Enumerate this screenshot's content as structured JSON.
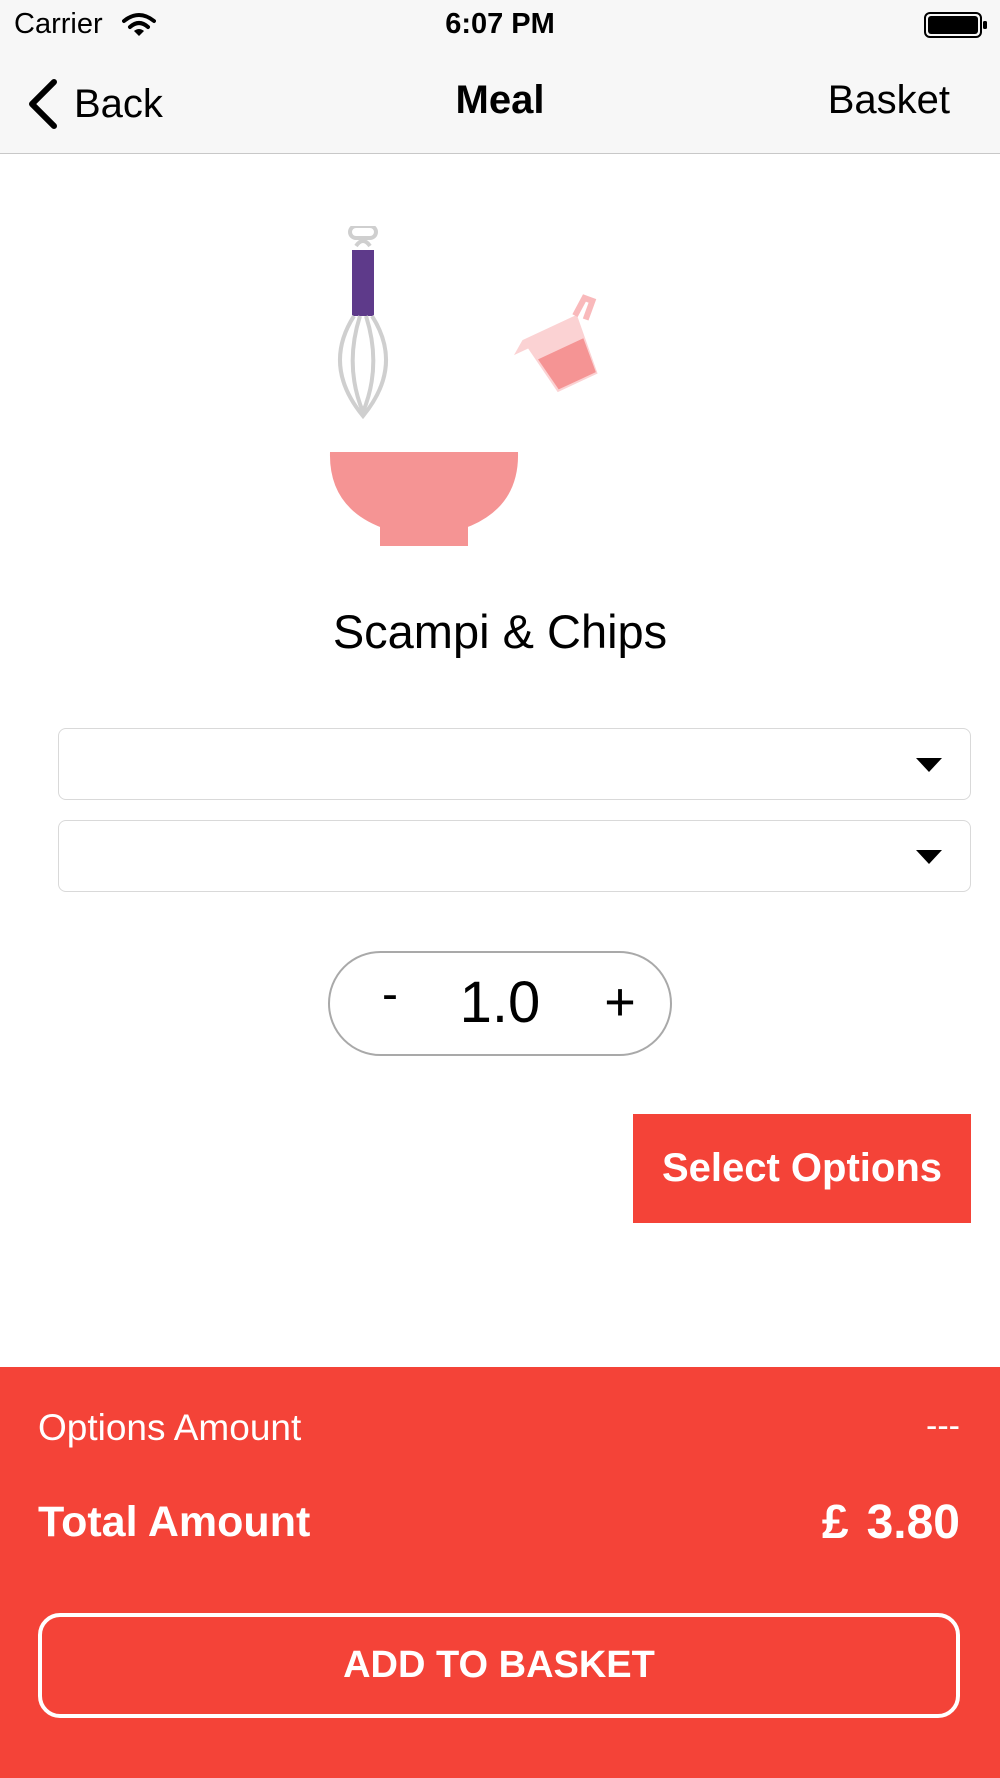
{
  "status_bar": {
    "carrier": "Carrier",
    "time": "6:07 PM",
    "wifi_icon": "wifi-icon",
    "battery_icon": "battery-icon"
  },
  "nav": {
    "back_label": "Back",
    "back_icon": "chevron-left-icon",
    "title": "Meal",
    "basket_label": "Basket"
  },
  "illustration_icon": "whisk-bowl-measuring-cup-illustration",
  "meal": {
    "name": "Scampi & Chips"
  },
  "dropdowns": [
    {
      "selected": ""
    },
    {
      "selected": ""
    }
  ],
  "stepper": {
    "minus": "-",
    "value": "1.0",
    "plus": "+"
  },
  "select_options_label": "Select Options",
  "summary": {
    "options_label": "Options Amount",
    "options_value": "---",
    "total_label": "Total Amount",
    "currency": "£",
    "total_value": "3.80",
    "add_to_basket_label": "ADD TO BASKET"
  },
  "colors": {
    "accent": "#f44338",
    "bowl": "#f59494",
    "whisk_handle": "#5e3a8a",
    "cup": "#f9b9bb"
  }
}
